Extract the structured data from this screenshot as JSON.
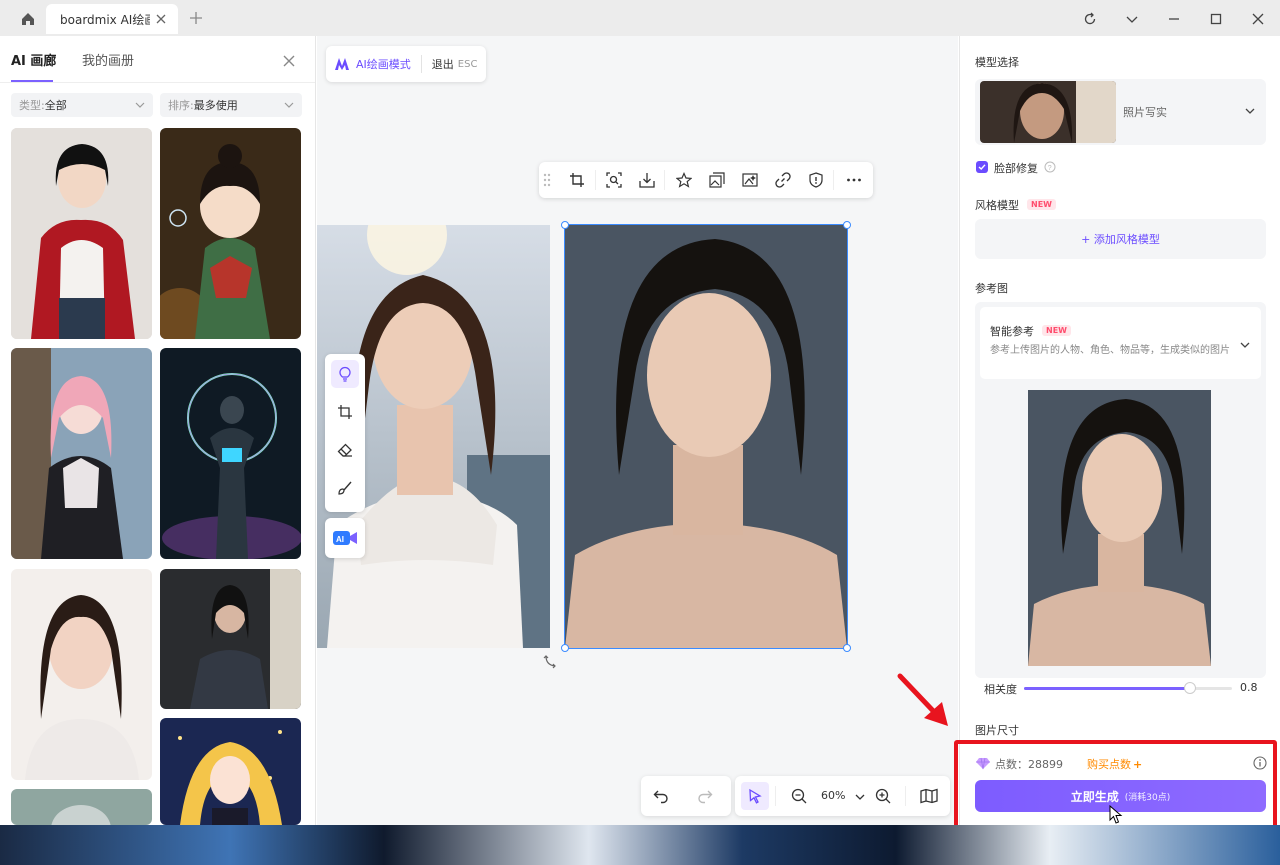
{
  "titlebar": {
    "tab_title": "boardmix AI绘画",
    "icons": [
      "home-icon",
      "close-icon",
      "plus-icon",
      "refresh-icon",
      "chevron-down-icon",
      "minimize-icon",
      "maximize-icon",
      "close-icon"
    ]
  },
  "gallery": {
    "tabs": [
      {
        "label": "AI 画廊",
        "active": true
      },
      {
        "label": "我的画册",
        "active": false
      }
    ],
    "filters": [
      {
        "label": "类型:",
        "value": "全部"
      },
      {
        "label": "排序:",
        "value": "最多使用"
      }
    ]
  },
  "canvas": {
    "mode_label": "AI绘画模式",
    "exit_label": "退出",
    "exit_key": "ESC",
    "zoom": "60%",
    "toolbar_icons": [
      "drag-handle-icon",
      "crop-icon",
      "search-zoom-icon",
      "download-icon",
      "star-icon",
      "images-icon",
      "image-ai-icon",
      "link-icon",
      "shield-icon",
      "more-icon"
    ]
  },
  "settings": {
    "model_section": "模型选择",
    "model_name": "照片写实",
    "face_fix_label": "脸部修复",
    "face_fix_checked": true,
    "style_section": "风格模型",
    "new_badge": "NEW",
    "add_style_label": "+ 添加风格模型",
    "ref_section": "参考图",
    "ref_title": "智能参考",
    "ref_desc": "参考上传图片的人物、角色、物品等，生成类似的图片",
    "relevance_label": "相关度",
    "relevance_value": "0.8",
    "relevance_fraction": 0.8,
    "size_section": "图片尺寸",
    "credits_label": "点数：",
    "credits_value": "28899",
    "buy_credits_label": "购买点数",
    "generate_label": "立即生成",
    "generate_cost": "(消耗30点)"
  },
  "colors": {
    "accent": "#6b4cff",
    "highlight": "#e8141e",
    "buy": "#ff8a00"
  }
}
